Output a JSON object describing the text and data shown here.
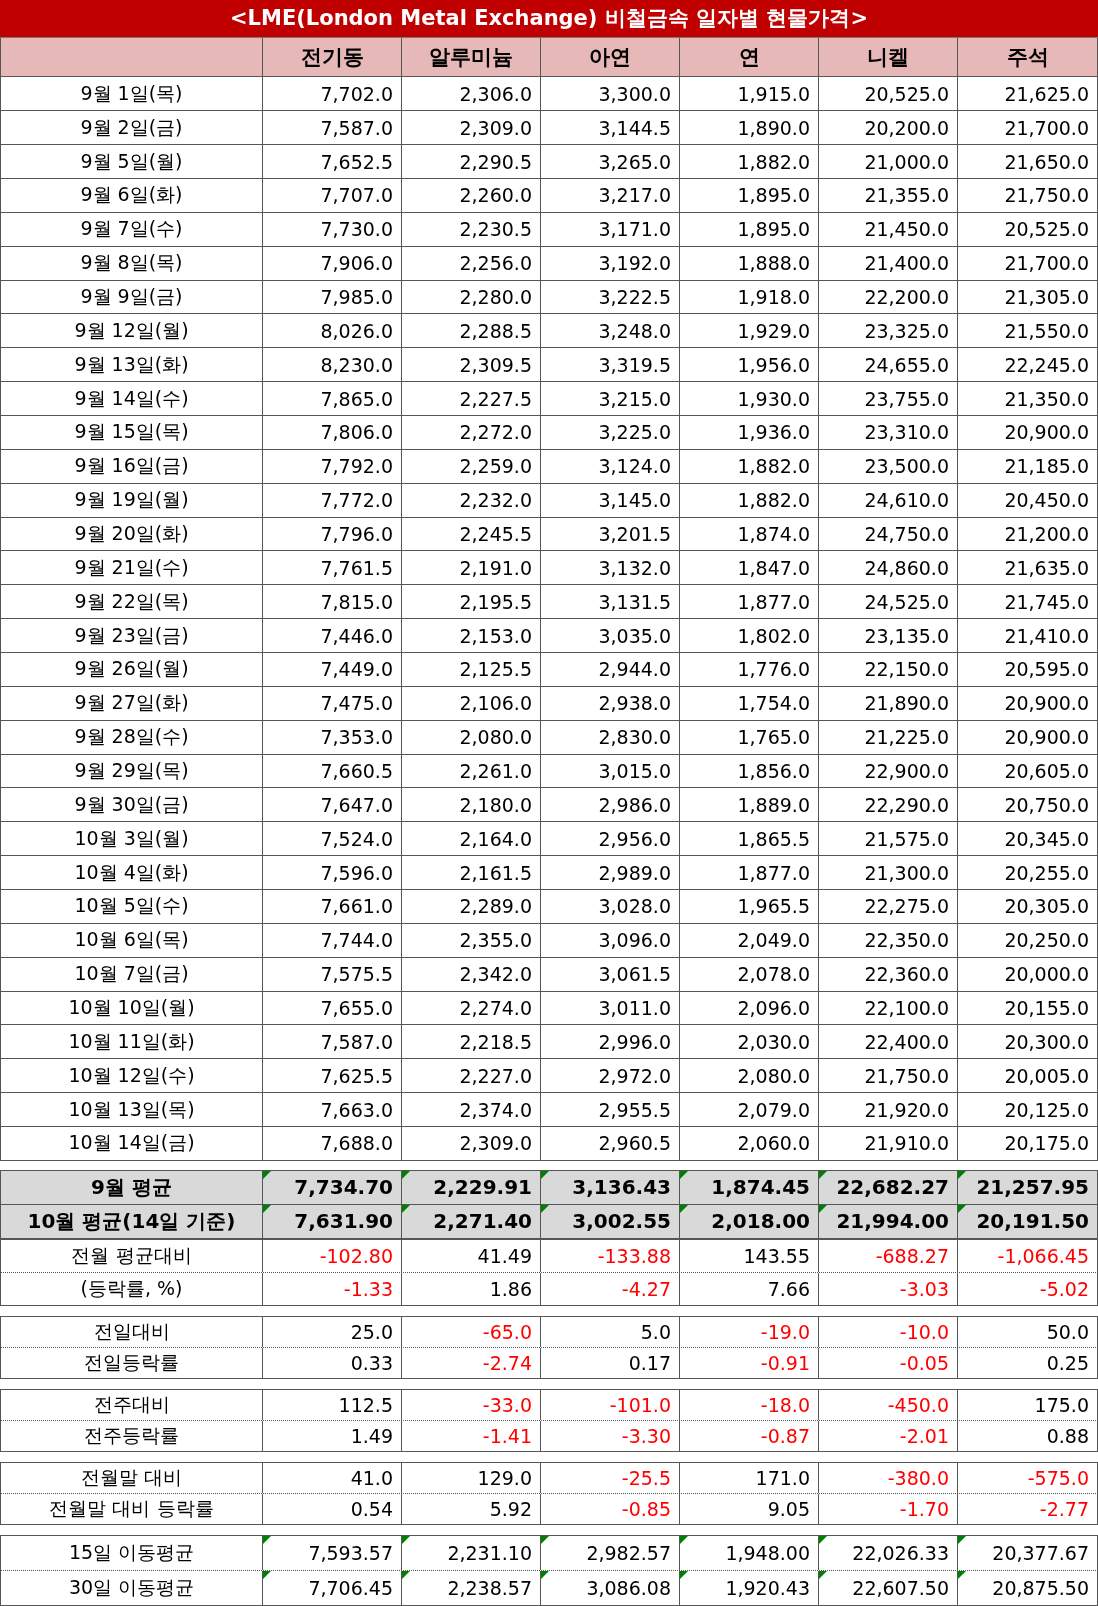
{
  "title": "<LME(London Metal Exchange) 비철금속 일자별 현물가격>",
  "columns": [
    "전기동",
    "알루미늄",
    "아연",
    "연",
    "니켈",
    "주석"
  ],
  "rows": [
    {
      "label": "9월  1일(목)",
      "values": [
        "7,702.0",
        "2,306.0",
        "3,300.0",
        "1,915.0",
        "20,525.0",
        "21,625.0"
      ]
    },
    {
      "label": "9월  2일(금)",
      "values": [
        "7,587.0",
        "2,309.0",
        "3,144.5",
        "1,890.0",
        "20,200.0",
        "21,700.0"
      ]
    },
    {
      "label": "9월  5일(월)",
      "values": [
        "7,652.5",
        "2,290.5",
        "3,265.0",
        "1,882.0",
        "21,000.0",
        "21,650.0"
      ]
    },
    {
      "label": "9월  6일(화)",
      "values": [
        "7,707.0",
        "2,260.0",
        "3,217.0",
        "1,895.0",
        "21,355.0",
        "21,750.0"
      ]
    },
    {
      "label": "9월  7일(수)",
      "values": [
        "7,730.0",
        "2,230.5",
        "3,171.0",
        "1,895.0",
        "21,450.0",
        "20,525.0"
      ]
    },
    {
      "label": "9월  8일(목)",
      "values": [
        "7,906.0",
        "2,256.0",
        "3,192.0",
        "1,888.0",
        "21,400.0",
        "21,700.0"
      ]
    },
    {
      "label": "9월  9일(금)",
      "values": [
        "7,985.0",
        "2,280.0",
        "3,222.5",
        "1,918.0",
        "22,200.0",
        "21,305.0"
      ]
    },
    {
      "label": "9월 12일(월)",
      "values": [
        "8,026.0",
        "2,288.5",
        "3,248.0",
        "1,929.0",
        "23,325.0",
        "21,550.0"
      ]
    },
    {
      "label": "9월 13일(화)",
      "values": [
        "8,230.0",
        "2,309.5",
        "3,319.5",
        "1,956.0",
        "24,655.0",
        "22,245.0"
      ]
    },
    {
      "label": "9월 14일(수)",
      "values": [
        "7,865.0",
        "2,227.5",
        "3,215.0",
        "1,930.0",
        "23,755.0",
        "21,350.0"
      ]
    },
    {
      "label": "9월 15일(목)",
      "values": [
        "7,806.0",
        "2,272.0",
        "3,225.0",
        "1,936.0",
        "23,310.0",
        "20,900.0"
      ]
    },
    {
      "label": "9월 16일(금)",
      "values": [
        "7,792.0",
        "2,259.0",
        "3,124.0",
        "1,882.0",
        "23,500.0",
        "21,185.0"
      ]
    },
    {
      "label": "9월 19일(월)",
      "values": [
        "7,772.0",
        "2,232.0",
        "3,145.0",
        "1,882.0",
        "24,610.0",
        "20,450.0"
      ]
    },
    {
      "label": "9월 20일(화)",
      "values": [
        "7,796.0",
        "2,245.5",
        "3,201.5",
        "1,874.0",
        "24,750.0",
        "21,200.0"
      ]
    },
    {
      "label": "9월 21일(수)",
      "values": [
        "7,761.5",
        "2,191.0",
        "3,132.0",
        "1,847.0",
        "24,860.0",
        "21,635.0"
      ]
    },
    {
      "label": "9월 22일(목)",
      "values": [
        "7,815.0",
        "2,195.5",
        "3,131.5",
        "1,877.0",
        "24,525.0",
        "21,745.0"
      ]
    },
    {
      "label": "9월 23일(금)",
      "values": [
        "7,446.0",
        "2,153.0",
        "3,035.0",
        "1,802.0",
        "23,135.0",
        "21,410.0"
      ]
    },
    {
      "label": "9월 26일(월)",
      "values": [
        "7,449.0",
        "2,125.5",
        "2,944.0",
        "1,776.0",
        "22,150.0",
        "20,595.0"
      ]
    },
    {
      "label": "9월 27일(화)",
      "values": [
        "7,475.0",
        "2,106.0",
        "2,938.0",
        "1,754.0",
        "21,890.0",
        "20,900.0"
      ]
    },
    {
      "label": "9월 28일(수)",
      "values": [
        "7,353.0",
        "2,080.0",
        "2,830.0",
        "1,765.0",
        "21,225.0",
        "20,900.0"
      ]
    },
    {
      "label": "9월 29일(목)",
      "values": [
        "7,660.5",
        "2,261.0",
        "3,015.0",
        "1,856.0",
        "22,900.0",
        "20,605.0"
      ]
    },
    {
      "label": "9월 30일(금)",
      "values": [
        "7,647.0",
        "2,180.0",
        "2,986.0",
        "1,889.0",
        "22,290.0",
        "20,750.0"
      ]
    },
    {
      "label": "10월  3일(월)",
      "values": [
        "7,524.0",
        "2,164.0",
        "2,956.0",
        "1,865.5",
        "21,575.0",
        "20,345.0"
      ]
    },
    {
      "label": "10월  4일(화)",
      "values": [
        "7,596.0",
        "2,161.5",
        "2,989.0",
        "1,877.0",
        "21,300.0",
        "20,255.0"
      ]
    },
    {
      "label": "10월  5일(수)",
      "values": [
        "7,661.0",
        "2,289.0",
        "3,028.0",
        "1,965.5",
        "22,275.0",
        "20,305.0"
      ]
    },
    {
      "label": "10월  6일(목)",
      "values": [
        "7,744.0",
        "2,355.0",
        "3,096.0",
        "2,049.0",
        "22,350.0",
        "20,250.0"
      ]
    },
    {
      "label": "10월  7일(금)",
      "values": [
        "7,575.5",
        "2,342.0",
        "3,061.5",
        "2,078.0",
        "22,360.0",
        "20,000.0"
      ]
    },
    {
      "label": "10월 10일(월)",
      "values": [
        "7,655.0",
        "2,274.0",
        "3,011.0",
        "2,096.0",
        "22,100.0",
        "20,155.0"
      ]
    },
    {
      "label": "10월 11일(화)",
      "values": [
        "7,587.0",
        "2,218.5",
        "2,996.0",
        "2,030.0",
        "22,400.0",
        "20,300.0"
      ]
    },
    {
      "label": "10월 12일(수)",
      "values": [
        "7,625.5",
        "2,227.0",
        "2,972.0",
        "2,080.0",
        "21,750.0",
        "20,005.0"
      ]
    },
    {
      "label": "10월 13일(목)",
      "values": [
        "7,663.0",
        "2,374.0",
        "2,955.5",
        "2,079.0",
        "21,920.0",
        "20,125.0"
      ]
    },
    {
      "label": "10월 14일(금)",
      "values": [
        "7,688.0",
        "2,309.0",
        "2,960.5",
        "2,060.0",
        "21,910.0",
        "20,175.0"
      ]
    }
  ],
  "sections": [
    {
      "kind": "average",
      "rows": [
        {
          "label": "9월 평균",
          "error_marker": true,
          "cells": [
            {
              "v": "7,734.70",
              "negative": false
            },
            {
              "v": "2,229.91",
              "negative": false
            },
            {
              "v": "3,136.43",
              "negative": false
            },
            {
              "v": "1,874.45",
              "negative": false
            },
            {
              "v": "22,682.27",
              "negative": false
            },
            {
              "v": "21,257.95",
              "negative": false
            }
          ]
        },
        {
          "label": "10월 평균(14일 기준)",
          "error_marker": true,
          "cells": [
            {
              "v": "7,631.90",
              "negative": false
            },
            {
              "v": "2,271.40",
              "negative": false
            },
            {
              "v": "3,002.55",
              "negative": false
            },
            {
              "v": "2,018.00",
              "negative": false
            },
            {
              "v": "21,994.00",
              "negative": false
            },
            {
              "v": "20,191.50",
              "negative": false
            }
          ]
        }
      ]
    },
    {
      "kind": "change",
      "rows": [
        {
          "label": "전월 평균대비",
          "error_marker": false,
          "cells": [
            {
              "v": "-102.80",
              "negative": true
            },
            {
              "v": "41.49",
              "negative": false
            },
            {
              "v": "-133.88",
              "negative": true
            },
            {
              "v": "143.55",
              "negative": false
            },
            {
              "v": "-688.27",
              "negative": true
            },
            {
              "v": "-1,066.45",
              "negative": true
            }
          ]
        },
        {
          "label": "(등락률, %)",
          "error_marker": false,
          "cells": [
            {
              "v": "-1.33",
              "negative": true
            },
            {
              "v": "1.86",
              "negative": false
            },
            {
              "v": "-4.27",
              "negative": true
            },
            {
              "v": "7.66",
              "negative": false
            },
            {
              "v": "-3.03",
              "negative": true
            },
            {
              "v": "-5.02",
              "negative": true
            }
          ]
        }
      ]
    },
    {
      "kind": "pair",
      "rows": [
        {
          "label": "전일대비",
          "error_marker": false,
          "cells": [
            {
              "v": "25.0",
              "negative": false
            },
            {
              "v": "-65.0",
              "negative": true
            },
            {
              "v": "5.0",
              "negative": false
            },
            {
              "v": "-19.0",
              "negative": true
            },
            {
              "v": "-10.0",
              "negative": true
            },
            {
              "v": "50.0",
              "negative": false
            }
          ]
        },
        {
          "label": "전일등락률",
          "error_marker": false,
          "cells": [
            {
              "v": "0.33",
              "negative": false
            },
            {
              "v": "-2.74",
              "negative": true
            },
            {
              "v": "0.17",
              "negative": false
            },
            {
              "v": "-0.91",
              "negative": true
            },
            {
              "v": "-0.05",
              "negative": true
            },
            {
              "v": "0.25",
              "negative": false
            }
          ]
        }
      ]
    },
    {
      "kind": "pair",
      "rows": [
        {
          "label": "전주대비",
          "error_marker": false,
          "cells": [
            {
              "v": "112.5",
              "negative": false
            },
            {
              "v": "-33.0",
              "negative": true
            },
            {
              "v": "-101.0",
              "negative": true
            },
            {
              "v": "-18.0",
              "negative": true
            },
            {
              "v": "-450.0",
              "negative": true
            },
            {
              "v": "175.0",
              "negative": false
            }
          ]
        },
        {
          "label": "전주등락률",
          "error_marker": false,
          "cells": [
            {
              "v": "1.49",
              "negative": false
            },
            {
              "v": "-1.41",
              "negative": true
            },
            {
              "v": "-3.30",
              "negative": true
            },
            {
              "v": "-0.87",
              "negative": true
            },
            {
              "v": "-2.01",
              "negative": true
            },
            {
              "v": "0.88",
              "negative": false
            }
          ]
        }
      ]
    },
    {
      "kind": "pair",
      "rows": [
        {
          "label": "전월말 대비",
          "error_marker": false,
          "cells": [
            {
              "v": "41.0",
              "negative": false
            },
            {
              "v": "129.0",
              "negative": false
            },
            {
              "v": "-25.5",
              "negative": true
            },
            {
              "v": "171.0",
              "negative": false
            },
            {
              "v": "-380.0",
              "negative": true
            },
            {
              "v": "-575.0",
              "negative": true
            }
          ]
        },
        {
          "label": "전월말 대비 등락률",
          "error_marker": false,
          "cells": [
            {
              "v": "0.54",
              "negative": false
            },
            {
              "v": "5.92",
              "negative": false
            },
            {
              "v": "-0.85",
              "negative": true
            },
            {
              "v": "9.05",
              "negative": false
            },
            {
              "v": "-1.70",
              "negative": true
            },
            {
              "v": "-2.77",
              "negative": true
            }
          ]
        }
      ]
    },
    {
      "kind": "moving",
      "rows": [
        {
          "label": "15일 이동평균",
          "error_marker": true,
          "cells": [
            {
              "v": "7,593.57",
              "negative": false
            },
            {
              "v": "2,231.10",
              "negative": false
            },
            {
              "v": "2,982.57",
              "negative": false
            },
            {
              "v": "1,948.00",
              "negative": false
            },
            {
              "v": "22,026.33",
              "negative": false
            },
            {
              "v": "20,377.67",
              "negative": false
            }
          ]
        },
        {
          "label": "30일 이동평균",
          "error_marker": true,
          "cells": [
            {
              "v": "7,706.45",
              "negative": false
            },
            {
              "v": "2,238.57",
              "negative": false
            },
            {
              "v": "3,086.08",
              "negative": false
            },
            {
              "v": "1,920.43",
              "negative": false
            },
            {
              "v": "22,607.50",
              "negative": false
            },
            {
              "v": "20,875.50",
              "negative": false
            }
          ]
        }
      ]
    }
  ]
}
